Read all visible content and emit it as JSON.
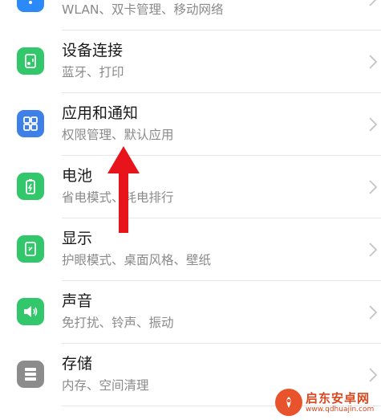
{
  "settings": {
    "items": [
      {
        "title": "",
        "subtitle": "WLAN、双卡管理、移动网络",
        "icon": "wifi-icon",
        "color": "#2b8af7"
      },
      {
        "title": "设备连接",
        "subtitle": "蓝牙、打印",
        "icon": "device-connection-icon",
        "color": "#33c76c"
      },
      {
        "title": "应用和通知",
        "subtitle": "权限管理、默认应用",
        "icon": "apps-grid-icon",
        "color": "#3f7fe8"
      },
      {
        "title": "电池",
        "subtitle": "省电模式、耗电排行",
        "icon": "battery-icon",
        "color": "#33c76c"
      },
      {
        "title": "显示",
        "subtitle": "护眼模式、桌面风格、壁纸",
        "icon": "display-icon",
        "color": "#33c76c"
      },
      {
        "title": "声音",
        "subtitle": "免打扰、铃声、振动",
        "icon": "sound-icon",
        "color": "#33c76c"
      },
      {
        "title": "存储",
        "subtitle": "内存、空间清理",
        "icon": "storage-icon",
        "color": "#8c8c8c"
      }
    ]
  },
  "annotation": {
    "arrow_color": "#e8141c"
  },
  "watermark": {
    "name": "启东安卓网",
    "url": "www.qdhuajin.com"
  }
}
